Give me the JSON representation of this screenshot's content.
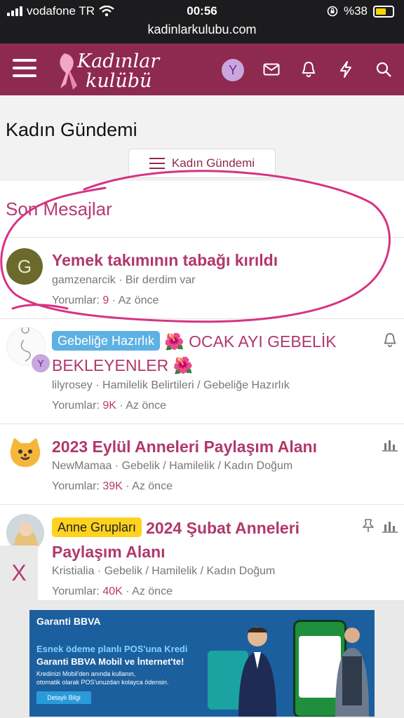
{
  "status": {
    "carrier": "vodafone TR",
    "time": "00:56",
    "battery": "%38",
    "url": "kadinlarkulubu.com"
  },
  "header": {
    "logo_line1": "Kadınlar",
    "logo_line2": "kulübü",
    "avatar_letter": "Y",
    "brand_color": "#8e2a4f"
  },
  "page": {
    "title": "Kadın Gündemi",
    "breadcrumb": "Kadın Gündemi"
  },
  "section": {
    "title": "Son Mesajlar"
  },
  "threads": [
    {
      "avatar_letter": "G",
      "title": "Yemek takımının tabağı kırıldı",
      "author": "gamzenarcik",
      "forum": "Bir derdim var",
      "replies_label": "Yorumlar:",
      "replies": "9",
      "time": "Az önce"
    },
    {
      "avatar_letter": "Y",
      "badge": "Gebeliğe Hazırlık",
      "title": "🌺 OCAK AYI GEBELİK BEKLEYENLER 🌺",
      "author": "lilyrosey",
      "forum": "Hamilelik Belirtileri / Gebeliğe Hazırlık",
      "replies_label": "Yorumlar:",
      "replies": "9K",
      "time": "Az önce"
    },
    {
      "title": "2023 Eylül Anneleri Paylaşım Alanı",
      "author": "NewMamaa",
      "forum": "Gebelik / Hamilelik / Kadın Doğum",
      "replies_label": "Yorumlar:",
      "replies": "39K",
      "time": "Az önce"
    },
    {
      "badge": "Anne Grupları",
      "title": "2024 Şubat Anneleri Paylaşım Alanı",
      "author": "Kristialia",
      "forum": "Gebelik / Hamilelik / Kadın Doğum",
      "replies_label": "Yorumlar:",
      "replies": "40K",
      "time": "Az önce"
    }
  ],
  "ad": {
    "close": "X",
    "brand": "Garanti BBVA",
    "headline1": "Esnek ödeme planlı POS'una Kredi",
    "headline2": "Garanti BBVA Mobil ve İnternet'te!",
    "sub1": "Kredinizi Mobil'den anında kullanın,",
    "sub2": "otomatik olarak POS'unuzdan kolayca ödensin.",
    "cta": "Detaylı Bilgi"
  }
}
